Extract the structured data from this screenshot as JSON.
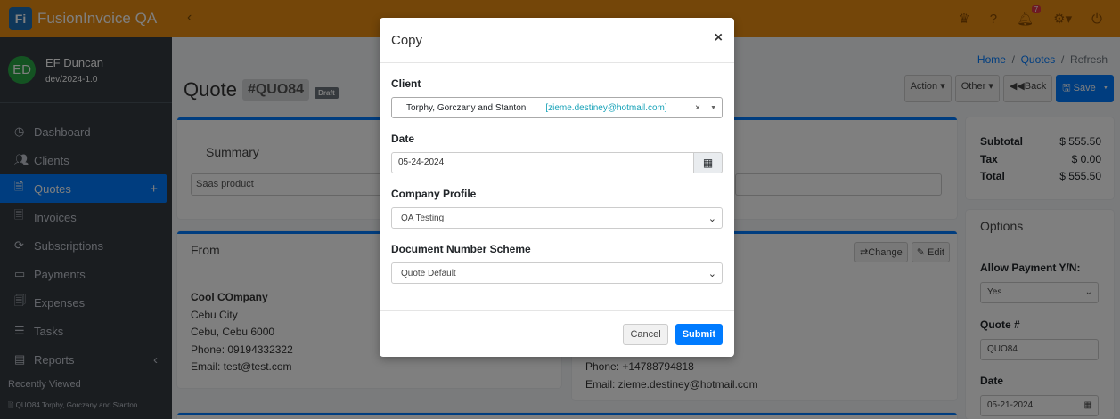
{
  "app": {
    "brand": "FusionInvoice QA",
    "logo_text": "Fi"
  },
  "topbar": {
    "notification_count": "7"
  },
  "user": {
    "initials": "ED",
    "name": "EF Duncan",
    "version": "dev/2024-1.0"
  },
  "sidebar": {
    "items": [
      {
        "label": "Dashboard",
        "icon": "dashboard-icon"
      },
      {
        "label": "Clients",
        "icon": "users-icon"
      },
      {
        "label": "Quotes",
        "icon": "file-icon",
        "active": true
      },
      {
        "label": "Invoices",
        "icon": "invoice-icon"
      },
      {
        "label": "Subscriptions",
        "icon": "sync-icon"
      },
      {
        "label": "Payments",
        "icon": "credit-card-icon"
      },
      {
        "label": "Expenses",
        "icon": "receipt-icon"
      },
      {
        "label": "Tasks",
        "icon": "tasks-icon"
      },
      {
        "label": "Reports",
        "icon": "chart-icon"
      }
    ],
    "recently_viewed_title": "Recently Viewed",
    "recent_item": "QUO84 Torphy, Gorczany and Stanton"
  },
  "breadcrumb": {
    "home": "Home",
    "quotes": "Quotes",
    "refresh": "Refresh"
  },
  "page": {
    "title": "Quote",
    "number": "#QUO84",
    "status": "Draft"
  },
  "actions": {
    "action": "Action",
    "other": "Other",
    "back": "Back",
    "save": "Save"
  },
  "summary": {
    "label": "Summary",
    "value": "Saas product"
  },
  "from": {
    "title": "From",
    "company": "Cool COmpany",
    "city": "Cebu City",
    "region": "Cebu, Cebu 6000",
    "phone": "Phone: 09194332322",
    "email": "Email: test@test.com"
  },
  "to": {
    "change": "Change",
    "edit": "Edit",
    "phone": "Phone: +14788794818",
    "email": "Email: zieme.destiney@hotmail.com"
  },
  "totals": {
    "subtotal_label": "Subtotal",
    "subtotal": "$ 555.50",
    "tax_label": "Tax",
    "tax": "$ 0.00",
    "total_label": "Total",
    "total": "$ 555.50"
  },
  "options": {
    "title": "Options",
    "allow_payment_label": "Allow Payment Y/N:",
    "allow_payment_value": "Yes",
    "quote_no_label": "Quote #",
    "quote_no_value": "QUO84",
    "date_label": "Date",
    "date_value": "05-21-2024"
  },
  "modal": {
    "title": "Copy",
    "client_label": "Client",
    "client_name": "Torphy, Gorczany and Stanton",
    "client_email": "[zieme.destiney@hotmail.com]",
    "date_label": "Date",
    "date_value": "05-24-2024",
    "company_profile_label": "Company Profile",
    "company_profile_value": "QA Testing",
    "doc_scheme_label": "Document Number Scheme",
    "doc_scheme_value": "Quote Default",
    "cancel": "Cancel",
    "submit": "Submit"
  }
}
